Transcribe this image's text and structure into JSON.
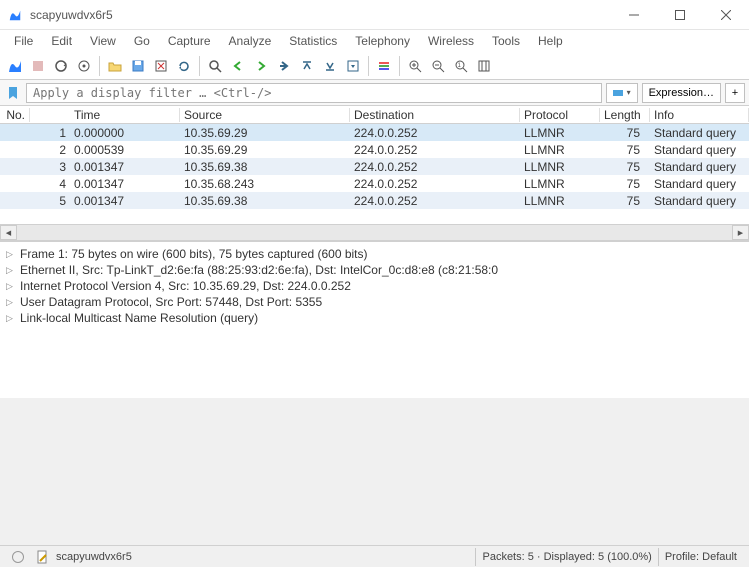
{
  "window": {
    "title": "scapyuwdvx6r5"
  },
  "menu": [
    "File",
    "Edit",
    "View",
    "Go",
    "Capture",
    "Analyze",
    "Statistics",
    "Telephony",
    "Wireless",
    "Tools",
    "Help"
  ],
  "filter": {
    "placeholder": "Apply a display filter … <Ctrl-/>",
    "expression": "Expression…",
    "plus": "+"
  },
  "columns": [
    "No.",
    "",
    "Time",
    "Source",
    "Destination",
    "Protocol",
    "Length",
    "Info"
  ],
  "packets": [
    {
      "no": "1",
      "time": "0.000000",
      "src": "10.35.69.29",
      "dst": "224.0.0.252",
      "proto": "LLMNR",
      "len": "75",
      "info": "Standard query"
    },
    {
      "no": "2",
      "time": "0.000539",
      "src": "10.35.69.29",
      "dst": "224.0.0.252",
      "proto": "LLMNR",
      "len": "75",
      "info": "Standard query"
    },
    {
      "no": "3",
      "time": "0.001347",
      "src": "10.35.69.38",
      "dst": "224.0.0.252",
      "proto": "LLMNR",
      "len": "75",
      "info": "Standard query"
    },
    {
      "no": "4",
      "time": "0.001347",
      "src": "10.35.68.243",
      "dst": "224.0.0.252",
      "proto": "LLMNR",
      "len": "75",
      "info": "Standard query"
    },
    {
      "no": "5",
      "time": "0.001347",
      "src": "10.35.69.38",
      "dst": "224.0.0.252",
      "proto": "LLMNR",
      "len": "75",
      "info": "Standard query"
    }
  ],
  "details": [
    "Frame 1: 75 bytes on wire (600 bits), 75 bytes captured (600 bits)",
    "Ethernet II, Src: Tp-LinkT_d2:6e:fa (88:25:93:d2:6e:fa), Dst: IntelCor_0c:d8:e8 (c8:21:58:0",
    "Internet Protocol Version 4, Src: 10.35.69.29, Dst: 224.0.0.252",
    "User Datagram Protocol, Src Port: 57448, Dst Port: 5355",
    "Link-local Multicast Name Resolution (query)"
  ],
  "status": {
    "file": "scapyuwdvx6r5",
    "packets": "Packets: 5 · Displayed: 5 (100.0%)",
    "profile": "Profile: Default"
  }
}
